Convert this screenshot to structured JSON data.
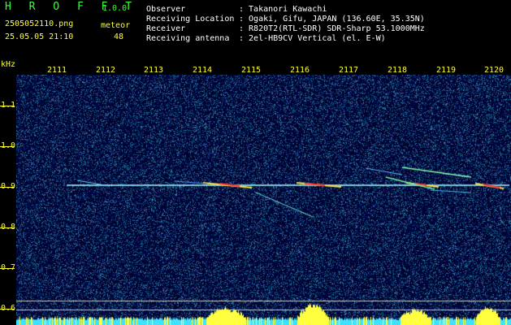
{
  "header": {
    "app_logo": "H R O F F T",
    "version": "1.0.0",
    "filename": "2505052110.png",
    "meteor_label": "meteor",
    "datetime": "25.05.05 21:10",
    "meteor_count": "48",
    "info_lines": [
      {
        "label": "Observer",
        "value": ": Takanori Kawachi"
      },
      {
        "label": "Receiving Location",
        "value": ": Ogaki, Gifu, JAPAN (136.60E, 35.35N)"
      },
      {
        "label": "Receiver",
        "value": ": R820T2(RTL-SDR) SDR-Sharp 53.1000MHz"
      },
      {
        "label": "Receiving antenna",
        "value": ": 2el-HB9CV Vertical (el. E-W)"
      }
    ]
  },
  "axes": {
    "unit": "kHz",
    "y_ticks": [
      "1.1",
      "1.0",
      "0.9",
      "0.8",
      "0.7",
      "0.6"
    ],
    "x_ticks": [
      "2111",
      "2112",
      "2113",
      "2114",
      "2115",
      "2116",
      "2117",
      "2118",
      "2119",
      "2120"
    ]
  },
  "colors": {
    "background": "#00003a",
    "axis_text": "#ffff33",
    "carrier": "#a0ffff",
    "echo_hot": "#ff3030",
    "echo_warm": "#ffe040",
    "noise_bar": "#ffff40"
  }
}
